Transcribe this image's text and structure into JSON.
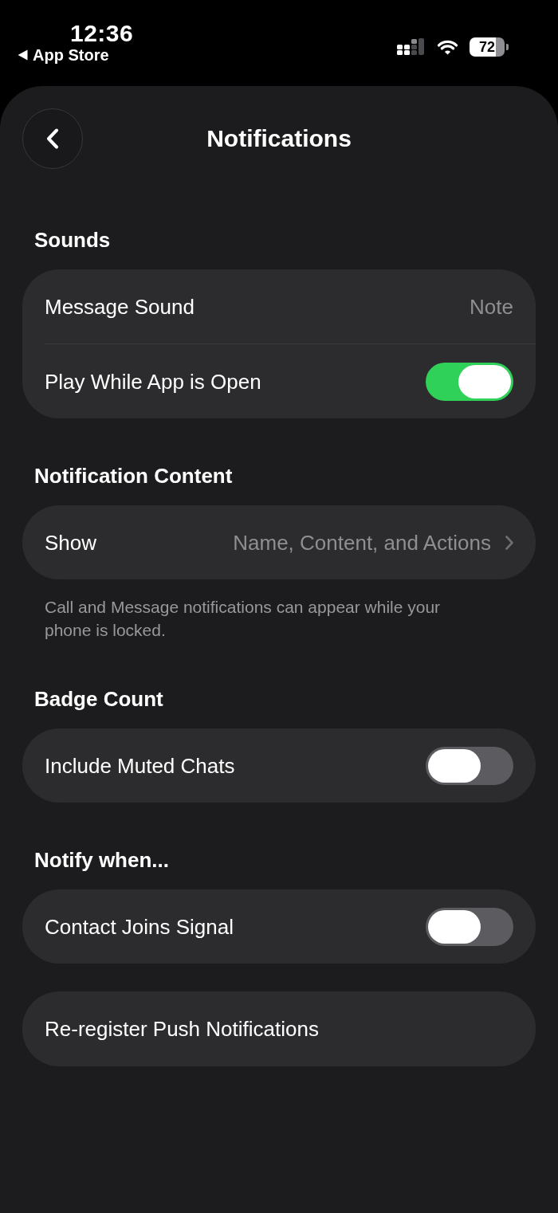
{
  "status_bar": {
    "time": "12:36",
    "back_label": "App Store",
    "battery": "72"
  },
  "header": {
    "title": "Notifications"
  },
  "sections": [
    {
      "heading": "Sounds",
      "rows": [
        {
          "kind": "value",
          "label": "Message Sound",
          "value": "Note"
        },
        {
          "kind": "toggle",
          "label": "Play While App is Open",
          "on": true
        }
      ]
    },
    {
      "heading": "Notification Content",
      "rows": [
        {
          "kind": "link",
          "label": "Show",
          "value": "Name, Content, and Actions"
        }
      ],
      "footer": "Call and Message notifications can appear while your phone is locked."
    },
    {
      "heading": "Badge Count",
      "rows": [
        {
          "kind": "toggle",
          "label": "Include Muted Chats",
          "on": false
        }
      ]
    },
    {
      "heading": "Notify when...",
      "rows": [
        {
          "kind": "toggle",
          "label": "Contact Joins Signal",
          "on": false
        }
      ]
    },
    {
      "rows": [
        {
          "kind": "action",
          "label": "Re-register Push Notifications"
        }
      ]
    }
  ]
}
